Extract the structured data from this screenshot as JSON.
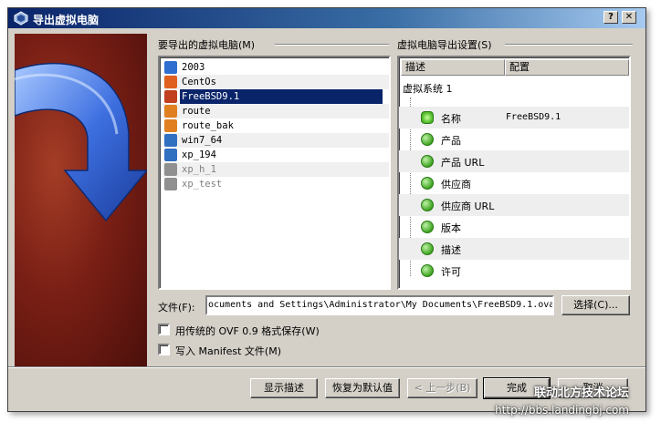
{
  "window": {
    "title": "导出虚拟电脑",
    "help_btn": "?",
    "close_btn": "✕"
  },
  "left_section": {
    "label": "要导出的虚拟电脑(M)"
  },
  "vms": [
    {
      "name": "2003",
      "state": "normal",
      "color": "#2f6fd0"
    },
    {
      "name": "CentOs",
      "state": "normal",
      "color": "#e06020"
    },
    {
      "name": "FreeBSD9.1",
      "state": "selected",
      "color": "#c04020"
    },
    {
      "name": "route",
      "state": "normal",
      "color": "#e08020"
    },
    {
      "name": "route_bak",
      "state": "normal",
      "color": "#e08020"
    },
    {
      "name": "win7_64",
      "state": "normal",
      "color": "#3070c0"
    },
    {
      "name": "xp_194",
      "state": "normal",
      "color": "#3070c0"
    },
    {
      "name": "xp_h_1",
      "state": "disabled",
      "color": "#909090"
    },
    {
      "name": "xp_test",
      "state": "disabled",
      "color": "#909090"
    }
  ],
  "right_section": {
    "label": "虚拟电脑导出设置(S)",
    "col_desc": "描述",
    "col_config": "配置",
    "root": "虚拟系统 1",
    "rows": [
      {
        "label": "名称",
        "value": "FreeBSD9.1",
        "icon": "name-star-icon"
      },
      {
        "label": "产品",
        "value": "",
        "icon": "product-icon"
      },
      {
        "label": "产品 URL",
        "value": "",
        "icon": "product-url-icon"
      },
      {
        "label": "供应商",
        "value": "",
        "icon": "vendor-icon"
      },
      {
        "label": "供应商 URL",
        "value": "",
        "icon": "vendor-url-icon"
      },
      {
        "label": "版本",
        "value": "",
        "icon": "version-icon"
      },
      {
        "label": "描述",
        "value": "",
        "icon": "description-icon"
      },
      {
        "label": "许可",
        "value": "",
        "icon": "license-icon"
      }
    ]
  },
  "file": {
    "label": "文件(F):",
    "value": "ocuments and Settings\\Administrator\\My Documents\\FreeBSD9.1.ova",
    "choose_btn": "选择(C)..."
  },
  "options": {
    "legacy_ovf": "用传统的 OVF 0.9 格式保存(W)",
    "manifest": "写入 Manifest 文件(M)"
  },
  "buttons": {
    "show_desc": "显示描述",
    "restore_defaults": "恢复为默认值",
    "back": "< 上一步(B)",
    "finish": "完成",
    "cancel": "取消"
  },
  "watermark": {
    "line1": "联动北方技术论坛",
    "line2": "http://bbs.landingbj.com"
  }
}
